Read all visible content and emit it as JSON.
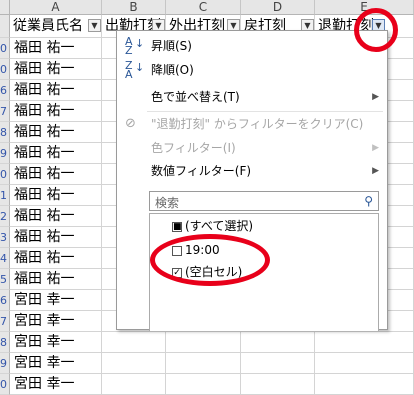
{
  "columns": [
    "A",
    "B",
    "C",
    "D",
    "E"
  ],
  "header_row": {
    "a": "従業員氏名",
    "b": "出勤打刻",
    "c": "外出打刻",
    "d": "戻打刻",
    "e": "退勤打刻"
  },
  "row_numbers": [
    "0",
    "0",
    "0",
    "6",
    "7",
    "8",
    "9",
    "0",
    "1",
    "2",
    "3",
    "4",
    "5",
    "6",
    "7",
    "8",
    "9",
    "0"
  ],
  "names": [
    "福田 祐一",
    "福田 祐一",
    "福田 祐一",
    "福田 祐一",
    "福田 祐一",
    "福田 祐一",
    "福田 祐一",
    "福田 祐一",
    "福田 祐一",
    "福田 祐一",
    "福田 祐一",
    "福田 祐一",
    "宮田 幸一",
    "宮田 幸一",
    "宮田 幸一",
    "宮田 幸一",
    "宮田 幸一"
  ],
  "filter_menu": {
    "sort_asc": "昇順(S)",
    "sort_desc": "降順(O)",
    "sort_by_color": "色で並べ替え(T)",
    "clear_filter": "\"退勤打刻\" からフィルターをクリア(C)",
    "color_filter": "色フィルター(I)",
    "number_filter": "数値フィルター(F)",
    "search_placeholder": "検索",
    "list_items": [
      "(すべて選択)",
      "19:00",
      "(空白セル)"
    ]
  },
  "colors": {
    "annotation_red": "#e8001a",
    "header_bg": "#e6e6e6",
    "icon_blue": "#2b5797"
  }
}
